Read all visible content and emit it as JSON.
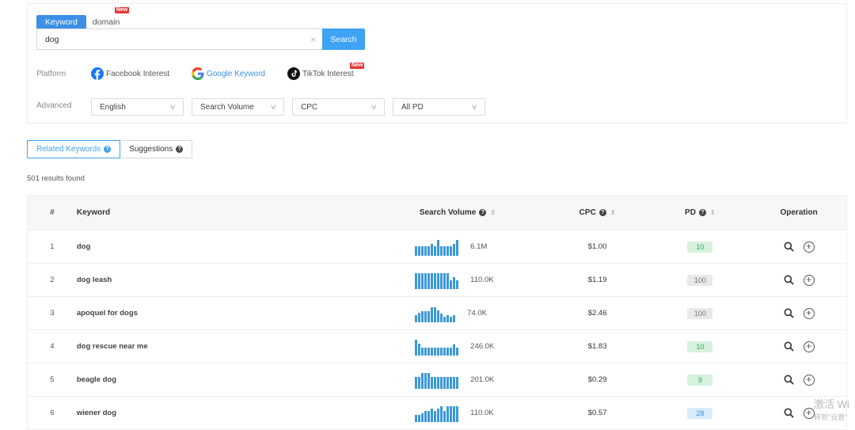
{
  "search": {
    "tabs": [
      {
        "label": "Keyword"
      },
      {
        "label": "domain",
        "badge": "New"
      }
    ],
    "query": "dog",
    "button_label": "Search",
    "clear_glyph": "×"
  },
  "platform": {
    "label": "Platform",
    "items": [
      {
        "label": "Facebook Interest",
        "icon": "facebook-icon"
      },
      {
        "label": "Google Keyword",
        "icon": "google-icon"
      },
      {
        "label": "TikTok Interest",
        "icon": "tiktok-icon",
        "badge": "New"
      }
    ]
  },
  "advanced": {
    "label": "Advanced",
    "selects": [
      "English",
      "Search Volume",
      "CPC",
      "All PD"
    ]
  },
  "result_tabs": [
    {
      "label": "Related Keywords"
    },
    {
      "label": "Suggestions"
    }
  ],
  "results_count": "501 results found",
  "table": {
    "headers": {
      "num": "#",
      "keyword": "Keyword",
      "search_volume": "Search Volume",
      "cpc": "CPC",
      "pd": "PD",
      "operation": "Operation"
    },
    "rows": [
      {
        "num": "1",
        "keyword": "dog",
        "volume": "6.1M",
        "cpc": "$1.00",
        "pd": "10",
        "pd_color": "green",
        "trend": [
          0.6,
          0.6,
          0.6,
          0.6,
          0.6,
          0.75,
          0.6,
          1.0,
          0.6,
          0.6,
          0.6,
          0.6,
          0.75,
          1.0
        ]
      },
      {
        "num": "2",
        "keyword": "dog leash",
        "volume": "110.0K",
        "cpc": "$1.19",
        "pd": "100",
        "pd_color": "gray",
        "trend": [
          1.0,
          1.0,
          1.0,
          1.0,
          1.0,
          1.0,
          1.0,
          1.0,
          1.0,
          1.0,
          1.0,
          0.55,
          0.75,
          0.55
        ]
      },
      {
        "num": "3",
        "keyword": "apoquel for dogs",
        "volume": "74.0K",
        "cpc": "$2.46",
        "pd": "100",
        "pd_color": "gray",
        "trend": [
          0.45,
          0.6,
          0.7,
          0.7,
          0.7,
          0.95,
          0.95,
          0.75,
          0.55,
          0.35,
          0.45,
          0.35,
          0.45
        ]
      },
      {
        "num": "4",
        "keyword": "dog rescue near me",
        "volume": "246.0K",
        "cpc": "$1.83",
        "pd": "10",
        "pd_color": "green",
        "trend": [
          1.0,
          0.75,
          0.5,
          0.5,
          0.5,
          0.5,
          0.5,
          0.5,
          0.5,
          0.5,
          0.5,
          0.5,
          0.7,
          0.5
        ]
      },
      {
        "num": "5",
        "keyword": "beagle dog",
        "volume": "201.0K",
        "cpc": "$0.29",
        "pd": "9",
        "pd_color": "green",
        "trend": [
          0.75,
          0.75,
          1.0,
          1.0,
          1.0,
          0.75,
          0.75,
          0.75,
          0.75,
          0.75,
          0.75,
          0.75,
          0.75,
          0.75
        ]
      },
      {
        "num": "6",
        "keyword": "wiener dog",
        "volume": "110.0K",
        "cpc": "$0.57",
        "pd": "28",
        "pd_color": "blue",
        "trend": [
          0.45,
          0.45,
          0.55,
          0.7,
          0.7,
          0.85,
          0.7,
          0.85,
          1.0,
          0.7,
          1.0,
          1.0,
          1.0,
          1.0
        ]
      }
    ]
  },
  "watermark": {
    "line1": "激活 Wi",
    "line2": "转到\"设置\""
  },
  "colors": {
    "accent": "#3ea2f5",
    "tab_active": "#3b8fe7",
    "spark": "#3c98d8",
    "badge_new": "#e53935"
  }
}
